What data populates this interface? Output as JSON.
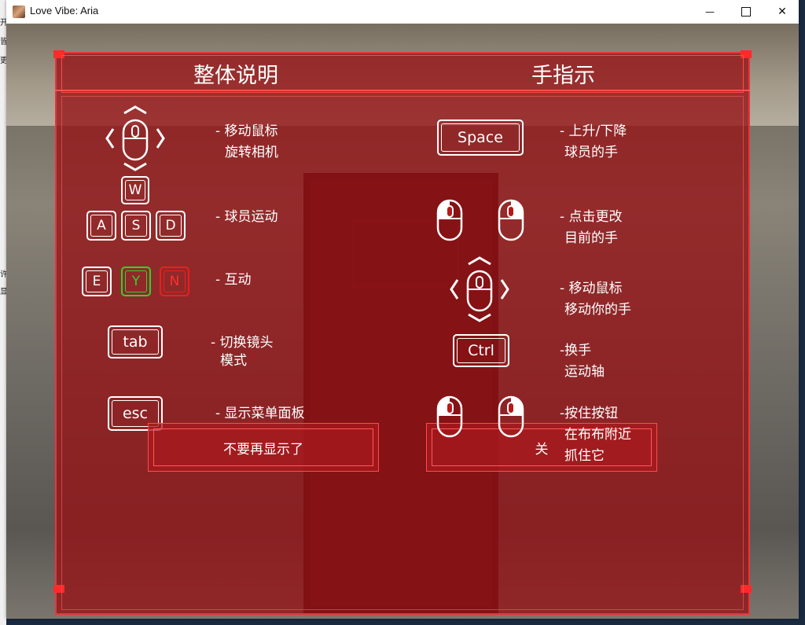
{
  "window": {
    "title": "Love Vibe: Aria",
    "minimize_glyph": "—",
    "close_glyph": "✕"
  },
  "desktop": {
    "side_chars": [
      "开",
      "皆",
      "更",
      "许",
      "显"
    ]
  },
  "left": {
    "heading": "整体说明",
    "keys": {
      "w": "W",
      "a": "A",
      "s": "S",
      "d": "D",
      "e": "E",
      "y": "Y",
      "n": "N",
      "tab": "tab",
      "esc": "esc"
    },
    "mouse_desc": [
      "- 移动鼠标",
      "旋转相机"
    ],
    "wasd_desc": "- 球员运动",
    "interact_desc": "- 互动",
    "tab_desc": [
      "- 切换镜头",
      "模式"
    ],
    "esc_desc": "- 显示菜单面板"
  },
  "right": {
    "heading": "手指示",
    "keys": {
      "space": "Space",
      "ctrl": "Ctrl"
    },
    "space_desc": [
      "- 上升/下降",
      "球员的手"
    ],
    "click_desc": [
      "- 点击更改",
      "目前的手"
    ],
    "move_desc": [
      "- 移动鼠标",
      "移动你的手"
    ],
    "ctrl_desc": [
      "-换手",
      "运动轴"
    ],
    "hold_desc": [
      "-按住按钮",
      "在布布附近",
      "抓住它"
    ]
  },
  "buttons": {
    "dont_show": "不要再显示了",
    "close": "关"
  },
  "colors": {
    "panel": "#96121680",
    "accent": "#ff2a2a",
    "yes_key": "#2ed42e",
    "no_key": "#e82020"
  }
}
